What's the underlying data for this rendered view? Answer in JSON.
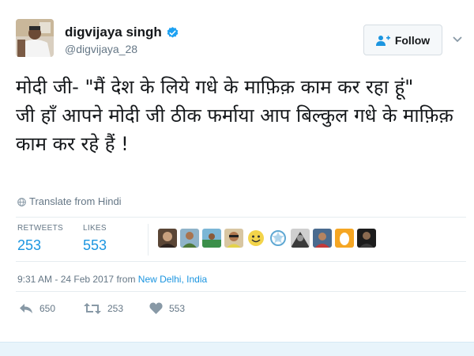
{
  "tweet": {
    "author_name": "digvijaya singh",
    "author_handle": "@digvijaya_28",
    "follow_label": "Follow",
    "text": "मोदी जी- \"मैं देश के लिये गधे के माफ़िक़  काम कर रहा हूं\"\nजी हाँ आपने मोदी जी ठीक फर्माया आप बिल्कुल गधे के माफ़िक़ काम कर रहे हैं !",
    "translate_label": "Translate from Hindi",
    "stats": {
      "retweets_label": "RETWEETS",
      "retweets_value": "253",
      "likes_label": "LIKES",
      "likes_value": "553"
    },
    "timestamp": "9:31 AM - 24 Feb 2017",
    "from_label": "from",
    "location": "New Delhi, India",
    "actions": {
      "reply_count": "650",
      "retweet_count": "253",
      "like_count": "553"
    }
  },
  "colors": {
    "accent": "#1b95e0",
    "verified": "#1da1f2",
    "muted": "#657786",
    "text": "#14171a"
  },
  "icons": {
    "verified": "verified-badge-icon",
    "follow": "add-user-icon",
    "caret": "chevron-down-icon",
    "translate": "globe-icon",
    "reply": "reply-icon",
    "retweet": "retweet-icon",
    "like": "heart-icon"
  }
}
